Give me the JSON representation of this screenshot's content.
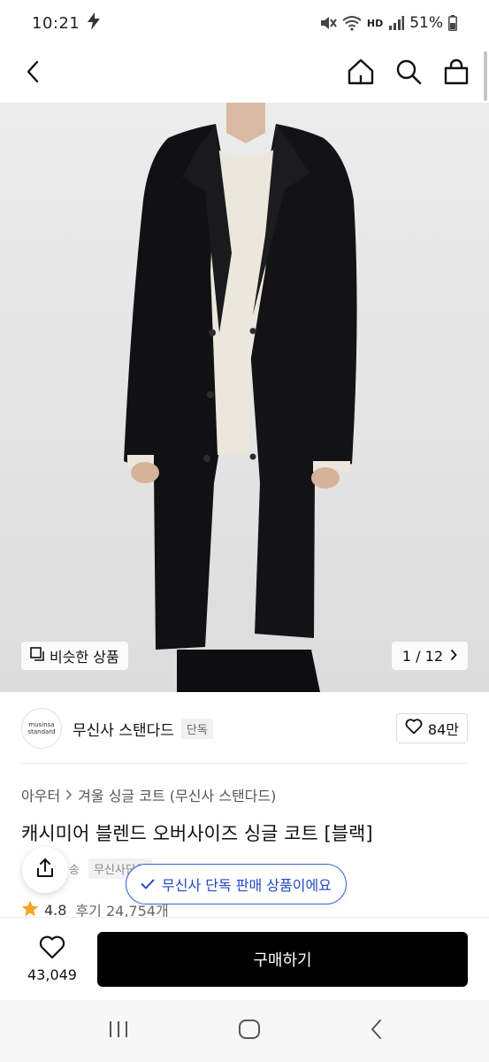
{
  "status_bar": {
    "time": "10:21",
    "battery": "51%",
    "network_label": "HD"
  },
  "header": {
    "back_icon": "chevron-left-icon",
    "home_icon": "home-icon",
    "search_icon": "search-icon",
    "cart_icon": "shopping-bag-icon"
  },
  "gallery": {
    "similar_products_label": "비슷한 상품",
    "page_counter": "1 / 12"
  },
  "brand": {
    "logo_line1": "musinsa",
    "logo_line2": "standard",
    "name": "무신사 스탠다드",
    "exclusive_tag": "단독",
    "like_count": "84만"
  },
  "product": {
    "breadcrumb": [
      "아우터",
      "겨울 싱글 코트 (무신사 스탠다드)"
    ],
    "title": "캐시미어 블렌드 오버사이즈 싱글 코트 [블랙]",
    "info_shipping": "송",
    "info_tag": "무신사단독",
    "rating": "4.8",
    "review_label": "후기 24,754개"
  },
  "toast": {
    "message": "무신사 단독 판매 상품이에요",
    "accent_color": "#2149c5"
  },
  "bottom_bar": {
    "favorite_count": "43,049",
    "buy_label": "구매하기"
  },
  "colors": {
    "star": "#f5a623",
    "buy_button": "#000000"
  }
}
